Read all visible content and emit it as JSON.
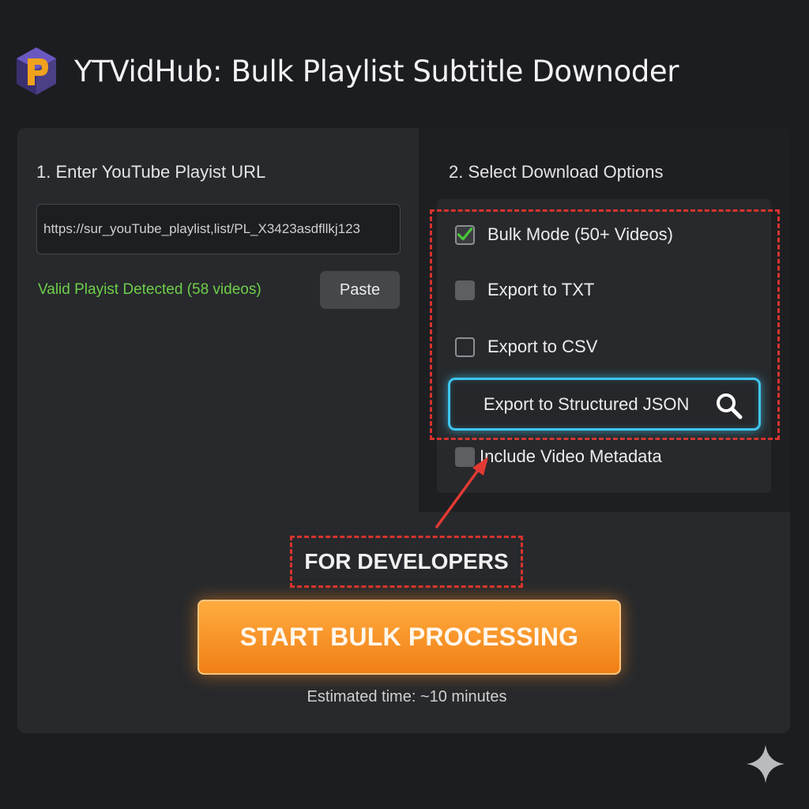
{
  "app": {
    "title": "YTVidHub: Bulk Playlist Subtitle Downoder"
  },
  "url_section": {
    "title": "1. Enter YouTube Playist URL",
    "url_value": "https://sur_youTube_playlist,list/PL_X3423asdfllkj123",
    "status": "Valid Playist Detected (58 videos)",
    "paste_label": "Paste"
  },
  "options_section": {
    "title": "2. Select Download Options",
    "options": [
      {
        "label": "Bulk Mode (50+ Videos)",
        "checked": true
      },
      {
        "label": "Export to TXT",
        "checked": false
      },
      {
        "label": "Export to CSV",
        "checked": false
      },
      {
        "label": "Export to Structured JSON",
        "checked": false
      },
      {
        "label": "Include Video Metadata",
        "checked": false
      }
    ]
  },
  "annotation": {
    "label": "FOR DEVELOPERS"
  },
  "action": {
    "start_label": "START BULK PROCESSING",
    "estimated_time": "Estimated time: ~10 minutes"
  },
  "colors": {
    "background": "#1c1d20",
    "card": "#27292c",
    "status_green": "#6fcf4a",
    "dashed_red": "#d8332e",
    "json_glow": "#3fc6ef",
    "start_orange": "#f58f22",
    "check_green": "#4cc83a"
  },
  "icons": [
    "logo-icon",
    "check-icon",
    "search-icon",
    "arrow-icon",
    "sparkle-icon"
  ]
}
